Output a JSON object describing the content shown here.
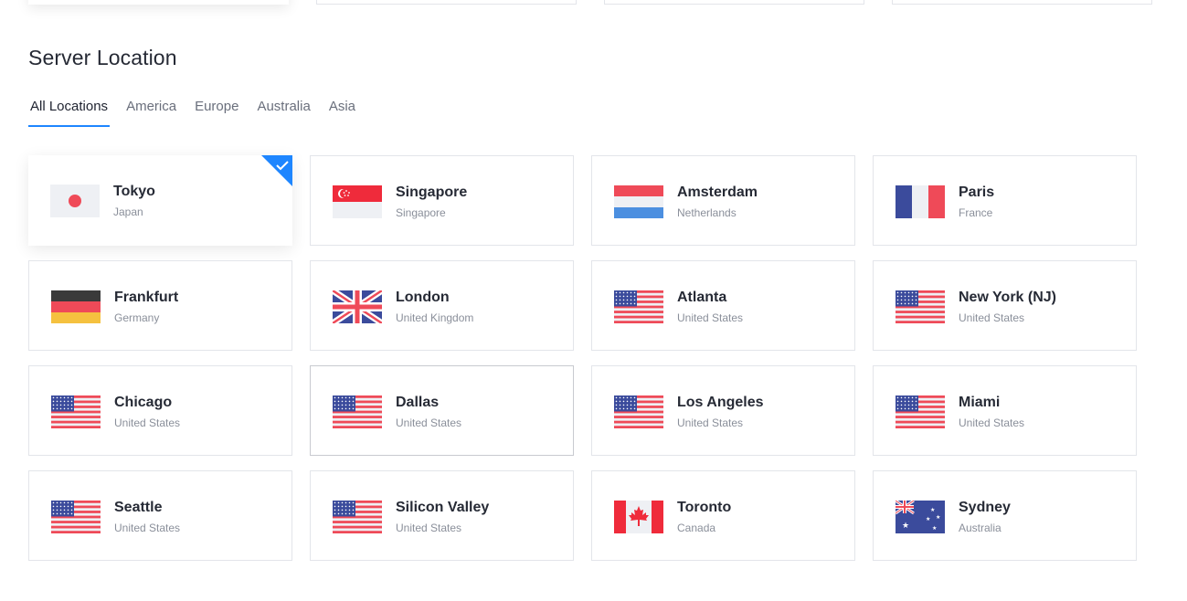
{
  "section": {
    "title": "Server Location"
  },
  "tabs": [
    {
      "label": "All Locations",
      "active": true
    },
    {
      "label": "America",
      "active": false
    },
    {
      "label": "Europe",
      "active": false
    },
    {
      "label": "Australia",
      "active": false
    },
    {
      "label": "Asia",
      "active": false
    }
  ],
  "locations": [
    {
      "city": "Tokyo",
      "country": "Japan",
      "flag": "japan-flag-icon",
      "selected": true
    },
    {
      "city": "Singapore",
      "country": "Singapore",
      "flag": "singapore-flag-icon",
      "selected": false
    },
    {
      "city": "Amsterdam",
      "country": "Netherlands",
      "flag": "netherlands-flag-icon",
      "selected": false
    },
    {
      "city": "Paris",
      "country": "France",
      "flag": "france-flag-icon",
      "selected": false
    },
    {
      "city": "Frankfurt",
      "country": "Germany",
      "flag": "germany-flag-icon",
      "selected": false
    },
    {
      "city": "London",
      "country": "United Kingdom",
      "flag": "uk-flag-icon",
      "selected": false
    },
    {
      "city": "Atlanta",
      "country": "United States",
      "flag": "us-flag-icon",
      "selected": false
    },
    {
      "city": "New York (NJ)",
      "country": "United States",
      "flag": "us-flag-icon",
      "selected": false
    },
    {
      "city": "Chicago",
      "country": "United States",
      "flag": "us-flag-icon",
      "selected": false
    },
    {
      "city": "Dallas",
      "country": "United States",
      "flag": "us-flag-icon",
      "selected": false
    },
    {
      "city": "Los Angeles",
      "country": "United States",
      "flag": "us-flag-icon",
      "selected": false
    },
    {
      "city": "Miami",
      "country": "United States",
      "flag": "us-flag-icon",
      "selected": false
    },
    {
      "city": "Seattle",
      "country": "United States",
      "flag": "us-flag-icon",
      "selected": false
    },
    {
      "city": "Silicon Valley",
      "country": "United States",
      "flag": "us-flag-icon",
      "selected": false
    },
    {
      "city": "Toronto",
      "country": "Canada",
      "flag": "canada-flag-icon",
      "selected": false
    },
    {
      "city": "Sydney",
      "country": "Australia",
      "flag": "australia-flag-icon",
      "selected": false
    }
  ],
  "colors": {
    "accent": "#1e86ff",
    "flag_red": "#ef4a58",
    "flag_blue": "#3b4b9c",
    "flag_light": "#eef0f4"
  }
}
